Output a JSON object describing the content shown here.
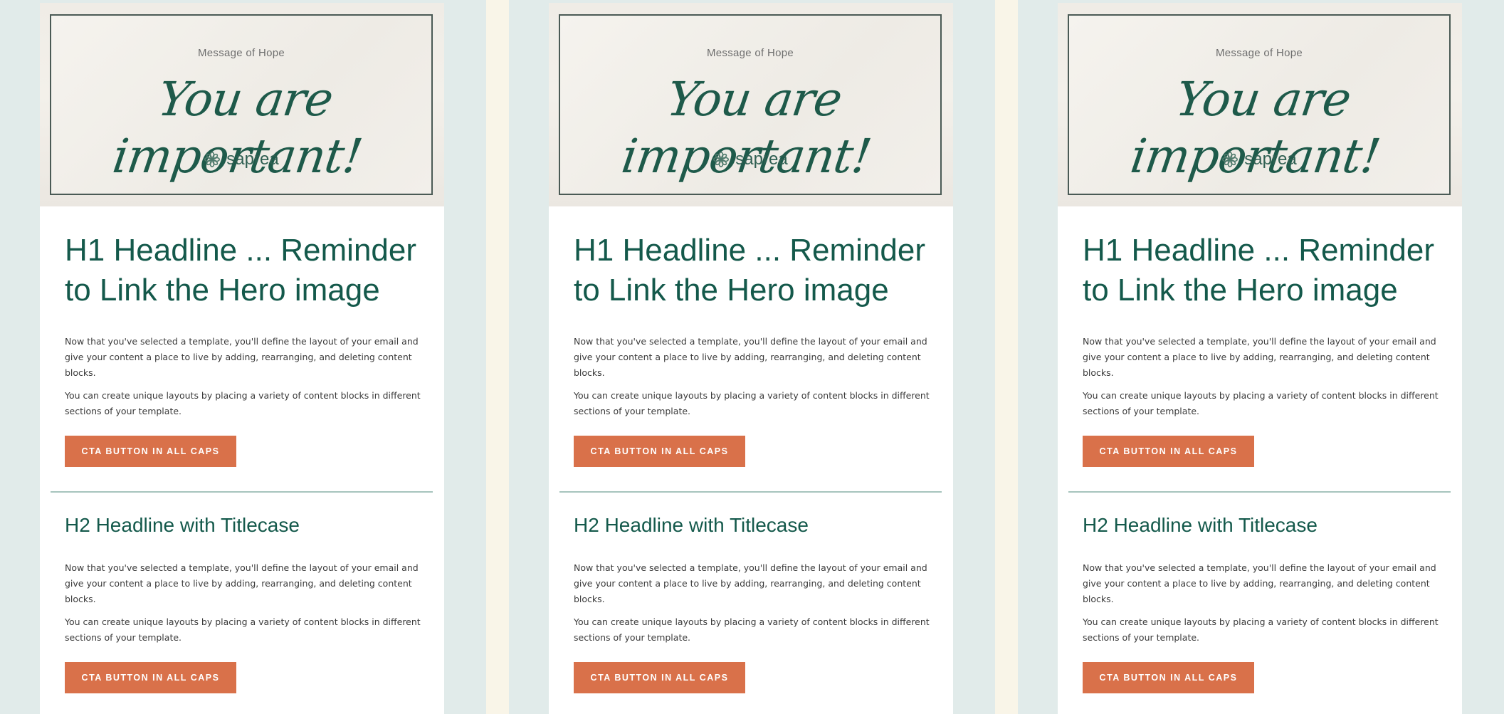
{
  "hero": {
    "kicker": "Message of Hope",
    "script_text": "You are important!",
    "logo_text": "saprea"
  },
  "content": {
    "h1": "H1 Headline ... Reminder to Link the Hero image",
    "paragraph_1": "Now that you've selected a template, you'll define the layout of your email and give your content a place to live by adding, rearranging, and deleting content blocks.",
    "paragraph_2": "You can create unique layouts by placing a variety of content blocks in different sections of your template.",
    "cta_1": "CTA BUTTON IN ALL CAPS",
    "h2": "H2 Headline with Titlecase",
    "paragraph_3": "Now that you've selected a template, you'll define the layout of your email and give your content a place to live by adding, rearranging, and deleting content blocks.",
    "paragraph_4": "You can create unique layouts by placing a variety of content blocks in different sections of your template.",
    "cta_2": "CTA BUTTON IN ALL CAPS"
  },
  "colors": {
    "page_background": "#f9f5e8",
    "panel_background": "#e1ebea",
    "headline": "#14594b",
    "cta_background": "#d9714a",
    "divider": "#a7c4bd"
  },
  "icons": {
    "logo": "flower-icon"
  }
}
